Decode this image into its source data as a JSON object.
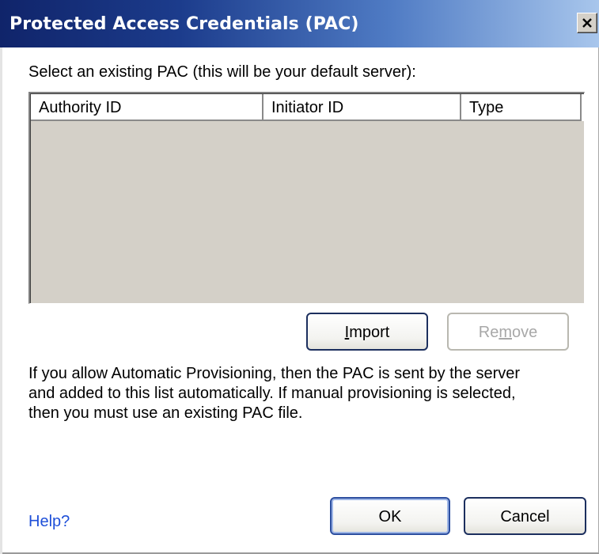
{
  "window": {
    "title": "Protected Access Credentials (PAC)"
  },
  "prompt": "Select an existing PAC (this will be your default server):",
  "list": {
    "columns": [
      "Authority ID",
      "Initiator ID",
      "Type"
    ],
    "rows": []
  },
  "buttons": {
    "import": {
      "label": "Import",
      "mnemonic": "I",
      "enabled": true
    },
    "remove": {
      "label": "Remove",
      "mnemonic": "m",
      "enabled": false
    },
    "ok": {
      "label": "OK",
      "default": true
    },
    "cancel": {
      "label": "Cancel"
    }
  },
  "info_lines": [
    "If you allow Automatic Provisioning, then the PAC is sent by the server",
    "and added to this list automatically.  If manual provisioning is selected,",
    "then you must use an existing PAC file."
  ],
  "help_link": "Help?",
  "icons": {
    "close": "close-icon"
  }
}
